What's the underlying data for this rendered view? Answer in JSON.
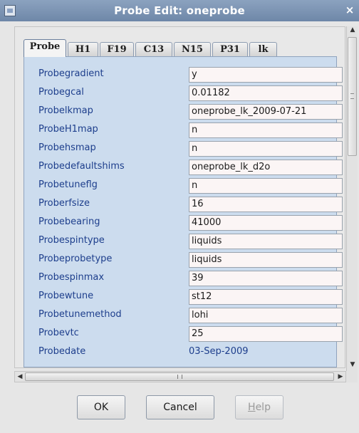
{
  "window": {
    "title": "Probe Edit: oneprobe",
    "close_glyph": "×"
  },
  "tabs": [
    {
      "label": "Probe",
      "active": true
    },
    {
      "label": "H1"
    },
    {
      "label": "F19"
    },
    {
      "label": "C13"
    },
    {
      "label": "N15"
    },
    {
      "label": "P31"
    },
    {
      "label": "lk"
    }
  ],
  "fields": [
    {
      "label": "Probegradient",
      "value": "y"
    },
    {
      "label": "Probegcal",
      "value": "0.01182"
    },
    {
      "label": "Probelkmap",
      "value": "oneprobe_lk_2009-07-21"
    },
    {
      "label": "ProbeH1map",
      "value": "n"
    },
    {
      "label": "Probehsmap",
      "value": "n"
    },
    {
      "label": "Probedefaultshims",
      "value": "oneprobe_lk_d2o"
    },
    {
      "label": "Probetuneflg",
      "value": "n"
    },
    {
      "label": "Proberfsize",
      "value": "16"
    },
    {
      "label": "Probebearing",
      "value": "41000"
    },
    {
      "label": "Probespintype",
      "value": "liquids"
    },
    {
      "label": "Probeprobetype",
      "value": "liquids"
    },
    {
      "label": "Probespinmax",
      "value": "39"
    },
    {
      "label": "Probewtune",
      "value": "st12"
    },
    {
      "label": "Probetunemethod",
      "value": "lohi"
    },
    {
      "label": "Probevtc",
      "value": "25"
    }
  ],
  "static_field": {
    "label": "Probedate",
    "value": "03-Sep-2009"
  },
  "buttons": {
    "ok": "OK",
    "cancel": "Cancel",
    "help_mnemonic": "H",
    "help_rest": "elp"
  },
  "icons": {
    "scroll_up": "▲",
    "scroll_down": "▼",
    "scroll_left": "◀",
    "scroll_right": "▶"
  }
}
